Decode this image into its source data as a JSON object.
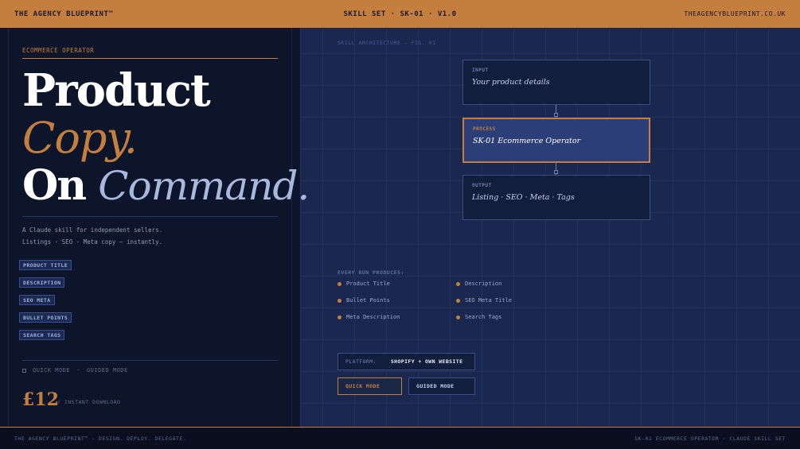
{
  "colors": {
    "accent": "#c47f3e",
    "navy": "#0c1529",
    "grid_panel": "#1a2850",
    "process_fill": "#2c3e77"
  },
  "topbar": {
    "brand": "THE AGENCY BLUEPRINT™",
    "center": "SKILL SET  ·  SK-01  ·  V1.0",
    "site": "THEAGENCYBLUEPRINT.CO.UK"
  },
  "hero": {
    "eyebrow": "ECOMMERCE OPERATOR",
    "line1": "Product",
    "line2": "Copy.",
    "line3a": "On ",
    "line3b": "Command.",
    "tagline1": "A Claude skill for independent sellers.",
    "tagline2": "Listings · SEO · Meta copy — instantly."
  },
  "chips": [
    "PRODUCT TITLE",
    "DESCRIPTION",
    "SEO META",
    "BULLET POINTS",
    "SEARCH TAGS"
  ],
  "modes_line": {
    "quick": "QUICK MODE",
    "sep": "·",
    "guided": "GUIDED MODE"
  },
  "pricing": {
    "price": "£12",
    "note": "/ INSTANT DOWNLOAD"
  },
  "diagram": {
    "fig_label": "SKILL ARCHITECTURE  —  FIG. 01",
    "input": {
      "tag": "INPUT",
      "text": "Your product details"
    },
    "process": {
      "tag": "PROCESS",
      "text": "SK-01 Ecommerce Operator"
    },
    "output": {
      "tag": "OUTPUT",
      "text": "Listing · SEO · Meta · Tags"
    }
  },
  "produces": {
    "label": "EVERY RUN PRODUCES:",
    "items": [
      "Product Title",
      "Description",
      "Bullet Points",
      "SEO Meta Title",
      "Meta Description",
      "Search Tags"
    ]
  },
  "platform": {
    "key": "PLATFORM:",
    "value": "SHOPIFY + OWN WEBSITE"
  },
  "buttons": {
    "quick": "QUICK MODE",
    "guided": "GUIDED MODE"
  },
  "footer": {
    "left": "THE AGENCY BLUEPRINT™  ·  DESIGN. DEPLOY. DELEGATE.",
    "right": "SK-01 ECOMMERCE OPERATOR  ·  CLAUDE SKILL SET"
  }
}
